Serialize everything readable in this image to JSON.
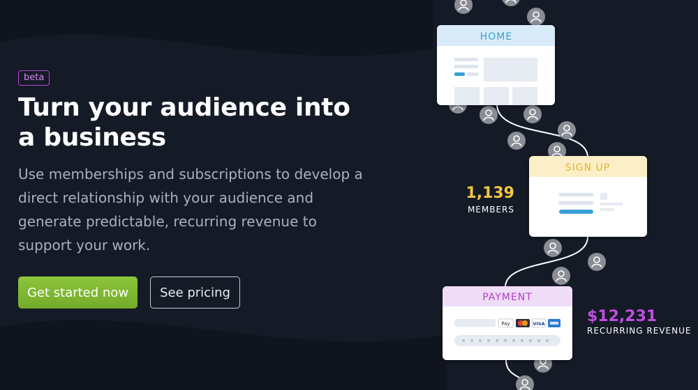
{
  "hero": {
    "badge": "beta",
    "headline_line1": "Turn your audience into",
    "headline_line2": "a business",
    "subtitle": "Use memberships and subscriptions to develop a direct relationship with your audience and generate predictable, recurring revenue to support your work."
  },
  "cta": {
    "primary_label": "Get started now",
    "secondary_label": "See pricing"
  },
  "flow": {
    "home_title": "HOME",
    "signup_title": "SIGN UP",
    "payment_title": "PAYMENT",
    "members_count": "1,139",
    "members_label": "MEMBERS",
    "revenue_amount": "$12,231",
    "revenue_label": "RECURRING REVENUE",
    "card_brands": [
      "Pay",
      "VISA"
    ]
  },
  "colors": {
    "background": "#151a27",
    "accent_green": "#7fb832",
    "badge_purple": "#b646d6",
    "members_yellow": "#f3c63f",
    "revenue_purple": "#c04fe0",
    "home_header": "#d9ebf8",
    "signup_header": "#fbefc7",
    "payment_header": "#efdcf6"
  }
}
